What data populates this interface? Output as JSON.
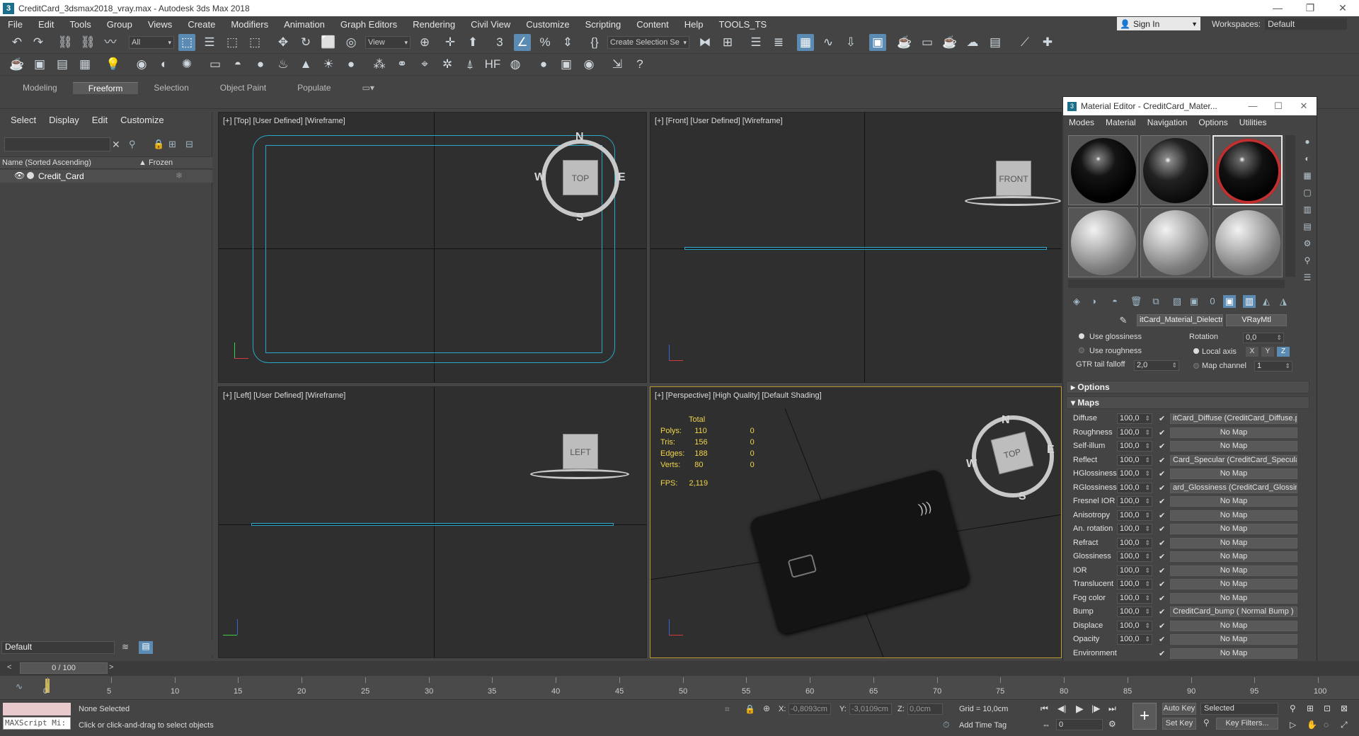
{
  "window": {
    "title": "CreditCard_3dsmax2018_vray.max - Autodesk 3ds Max 2018"
  },
  "menu": [
    "File",
    "Edit",
    "Tools",
    "Group",
    "Views",
    "Create",
    "Modifiers",
    "Animation",
    "Graph Editors",
    "Rendering",
    "Civil View",
    "Customize",
    "Scripting",
    "Content",
    "Help",
    "TOOLS_TS"
  ],
  "account": {
    "sign_in": "Sign In",
    "workspaces_label": "Workspaces:",
    "workspace_value": "Default"
  },
  "toolbar": {
    "selection_filter": "All",
    "ref_coord": "View",
    "named_selection": "Create Selection Se"
  },
  "ribbon": {
    "tabs": [
      "Modeling",
      "Freeform",
      "Selection",
      "Object Paint",
      "Populate"
    ],
    "active": "Freeform"
  },
  "scene_explorer": {
    "menu": [
      "Select",
      "Display",
      "Edit",
      "Customize"
    ],
    "columns": {
      "name": "Name (Sorted Ascending)",
      "frozen": "▲ Frozen"
    },
    "rows": [
      {
        "name": "Credit_Card"
      }
    ],
    "layer": "Default"
  },
  "viewports": {
    "top": {
      "label": "[+] [Top] [User Defined] [Wireframe]",
      "cube": "TOP",
      "compass": {
        "n": "N",
        "s": "S",
        "e": "E",
        "w": "W"
      }
    },
    "front": {
      "label": "[+] [Front] [User Defined] [Wireframe]",
      "cube": "FRONT"
    },
    "left": {
      "label": "[+] [Left] [User Defined] [Wireframe]",
      "cube": "LEFT"
    },
    "perspective": {
      "label": "[+] [Perspective] [High Quality] [Default Shading]",
      "cube": "TOP",
      "compass": {
        "n": "N",
        "s": "S",
        "e": "E",
        "w": "W"
      },
      "stats": {
        "header": "Total",
        "rows": [
          {
            "label": "Polys:",
            "total": "110",
            "sel": "0"
          },
          {
            "label": "Tris:",
            "total": "156",
            "sel": "0"
          },
          {
            "label": "Edges:",
            "total": "188",
            "sel": "0"
          },
          {
            "label": "Verts:",
            "total": "80",
            "sel": "0"
          }
        ],
        "fps_label": "FPS:",
        "fps": "2,119"
      }
    }
  },
  "material_editor": {
    "title": "Material Editor - CreditCard_Mater...",
    "menu": [
      "Modes",
      "Material",
      "Navigation",
      "Options",
      "Utilities"
    ],
    "material_name": "itCard_Material_Dielectric",
    "material_type": "VRayMtl",
    "params": {
      "use_glossiness": "Use glossiness",
      "use_roughness": "Use roughness",
      "gtr_label": "GTR tail falloff",
      "gtr_value": "2,0",
      "rotation_label": "Rotation",
      "rotation_value": "0,0",
      "local_axis": "Local axis",
      "axes": [
        "X",
        "Y",
        "Z"
      ],
      "map_channel_label": "Map channel",
      "map_channel_value": "1"
    },
    "rollouts": {
      "options": "Options",
      "maps": "Maps"
    },
    "maps": [
      {
        "label": "Diffuse",
        "amount": "100,0",
        "map": "itCard_Diffuse (CreditCard_Diffuse.p"
      },
      {
        "label": "Roughness",
        "amount": "100,0",
        "map": "No Map"
      },
      {
        "label": "Self-illum",
        "amount": "100,0",
        "map": "No Map"
      },
      {
        "label": "Reflect",
        "amount": "100,0",
        "map": "Card_Specular (CreditCard_Specular"
      },
      {
        "label": "HGlossiness",
        "amount": "100,0",
        "map": "No Map"
      },
      {
        "label": "RGlossiness",
        "amount": "100,0",
        "map": "ard_Glossiness (CreditCard_Glossines"
      },
      {
        "label": "Fresnel IOR",
        "amount": "100,0",
        "map": "No Map"
      },
      {
        "label": "Anisotropy",
        "amount": "100,0",
        "map": "No Map"
      },
      {
        "label": "An. rotation",
        "amount": "100,0",
        "map": "No Map"
      },
      {
        "label": "Refract",
        "amount": "100,0",
        "map": "No Map"
      },
      {
        "label": "Glossiness",
        "amount": "100,0",
        "map": "No Map"
      },
      {
        "label": "IOR",
        "amount": "100,0",
        "map": "No Map"
      },
      {
        "label": "Translucent",
        "amount": "100,0",
        "map": "No Map"
      },
      {
        "label": "Fog color",
        "amount": "100,0",
        "map": "No Map"
      },
      {
        "label": "Bump",
        "amount": "100,0",
        "map": "CreditCard_bump ( Normal Bump )"
      },
      {
        "label": "Displace",
        "amount": "100,0",
        "map": "No Map"
      },
      {
        "label": "Opacity",
        "amount": "100,0",
        "map": "No Map"
      },
      {
        "label": "Environment",
        "amount": "",
        "map": "No Map"
      }
    ]
  },
  "timeline": {
    "frame": "0 / 100",
    "ticks": [
      "0",
      "5",
      "10",
      "15",
      "20",
      "25",
      "30",
      "35",
      "40",
      "45",
      "50",
      "55",
      "60",
      "65",
      "70",
      "75",
      "80",
      "85",
      "90",
      "95",
      "100"
    ]
  },
  "status": {
    "maxscript": "MAXScript Mi:",
    "selection": "None Selected",
    "prompt": "Click or click-and-drag to select objects",
    "x_label": "X:",
    "x": "-0,8093cm",
    "y_label": "Y:",
    "y": "-3,0109cm",
    "z_label": "Z:",
    "z": "0,0cm",
    "grid": "Grid = 10,0cm",
    "add_time_tag": "Add Time Tag",
    "auto_key": "Auto Key",
    "set_key": "Set Key",
    "key_mode": "Selected",
    "key_filters": "Key Filters...",
    "current_frame": "0"
  },
  "colors": {
    "accent": "#5b8bb3",
    "wire": "#2aa7c8",
    "stats": "#f1d44a",
    "active_vp": "#b8962e"
  }
}
